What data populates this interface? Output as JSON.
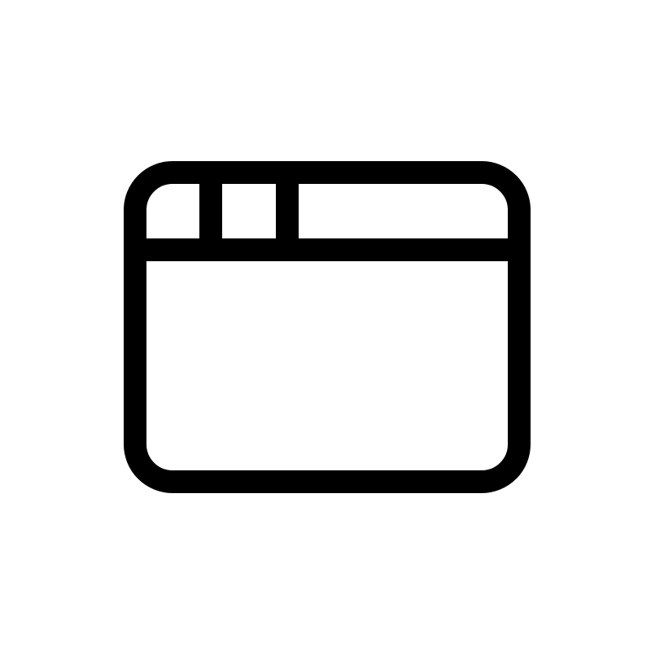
{
  "icon": {
    "name": "browser-window-icon",
    "stroke_color": "#000000",
    "fill_color": "#ffffff",
    "background_color": "#ffffff"
  }
}
